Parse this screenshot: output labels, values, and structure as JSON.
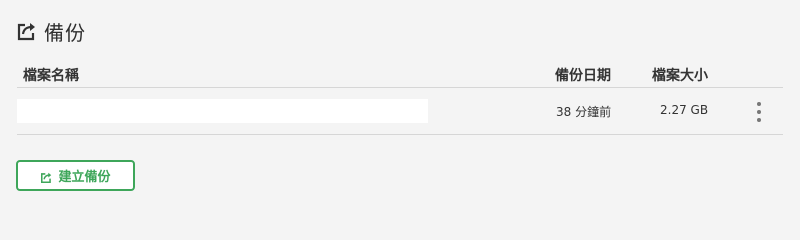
{
  "header": {
    "title": "備份",
    "icon": "share-export-icon"
  },
  "table": {
    "columns": {
      "name": "檔案名稱",
      "date": "備份日期",
      "size": "檔案大小"
    },
    "rows": [
      {
        "name": "",
        "date": "38 分鐘前",
        "size": "2.27 GB",
        "menu_icon": "kebab-menu-icon"
      }
    ]
  },
  "actions": {
    "create_backup_label": "建立備份",
    "create_backup_icon": "share-export-icon"
  },
  "colors": {
    "background": "#f4f4f4",
    "accent_green": "#3ea65a",
    "divider": "#d6d6d6",
    "text": "#333333"
  }
}
